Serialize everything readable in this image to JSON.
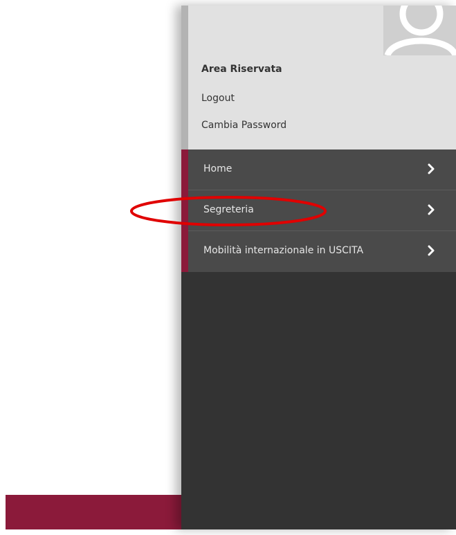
{
  "user_panel": {
    "title": "Area Riservata",
    "links": [
      "Logout",
      "Cambia Password"
    ],
    "avatar_icon": "user-silhouette-icon"
  },
  "menu": {
    "items": [
      {
        "label": "Home",
        "icon": "chevron-right-icon"
      },
      {
        "label": "Segreteria",
        "icon": "chevron-right-icon"
      },
      {
        "label": "Mobilità internazionale in USCITA",
        "icon": "chevron-right-icon"
      }
    ]
  },
  "colors": {
    "brand": "#8b1a3a",
    "drawer_bg": "#333333",
    "menu_bg": "#4a4a4a",
    "user_panel_bg": "#e1e1e1",
    "annotation": "#e00000"
  }
}
